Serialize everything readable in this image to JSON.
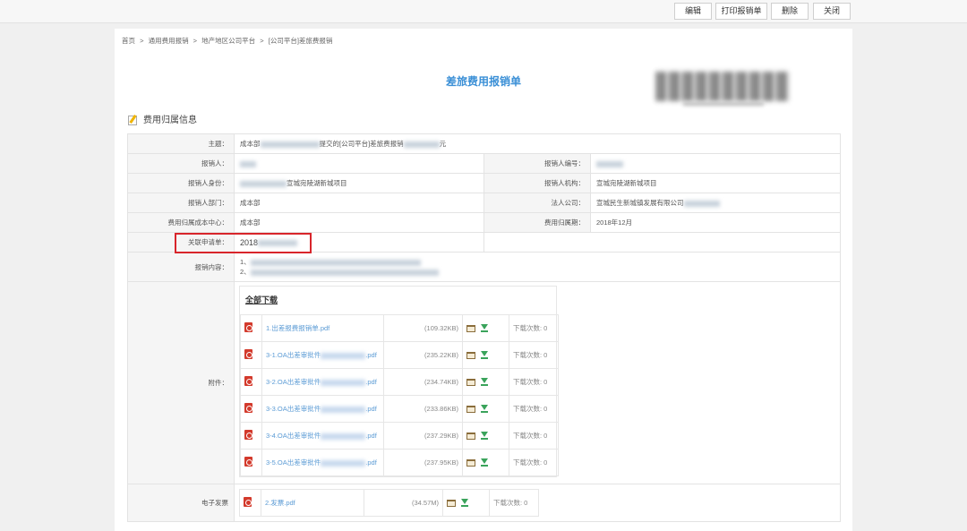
{
  "toolbar": {
    "edit": "编辑",
    "print": "打印报销单",
    "delete": "删除",
    "close": "关闭"
  },
  "breadcrumb": [
    "首页",
    ">",
    "通用费用报销",
    ">",
    "地产地区公司平台",
    ">",
    "[公司平台]差旅费报销"
  ],
  "form_title": "差旅费用报销单",
  "section_title": "费用归属信息",
  "fields": {
    "subject_label": "主题：",
    "subject_prefix": "成本部",
    "subject_mid": "提交的[公司平台]差旅费报销",
    "subject_suffix": "元",
    "claimant_label": "报销人：",
    "claimant_no_label": "报销人编号：",
    "id_label": "报销人身份：",
    "id_value": "宣城宛陵湖新城项目",
    "org_label": "报销人机构：",
    "org_value": "宣城宛陵湖新城项目",
    "dept_label": "报销人部门：",
    "dept_value": "成本部",
    "company_label": "法人公司：",
    "company_value": "宣城民生新城镇发展有限公司",
    "cost_center_label": "费用归属成本中心：",
    "cost_center_value": "成本部",
    "period_label": "费用归属期：",
    "period_value": "2018年12月",
    "linked_label": "关联申请单：",
    "linked_value": "2018",
    "content_label": "报销内容：",
    "content_line1": "1、",
    "content_line2": "2、",
    "attach_label": "附件：",
    "einvoice_label": "电子发票"
  },
  "download_all": "全部下载",
  "attachments": [
    {
      "name": "1.出差报费报销单.pdf",
      "size": "(109.32KB)",
      "count": "下载次数: 0"
    },
    {
      "name_prefix": "3-1.OA出差审批件",
      "ext": ".pdf",
      "size": "(235.22KB)",
      "count": "下载次数: 0"
    },
    {
      "name_prefix": "3-2.OA出差审批件",
      "ext": ".pdf",
      "size": "(234.74KB)",
      "count": "下载次数: 0"
    },
    {
      "name_prefix": "3-3.OA出差审批件",
      "ext": ".pdf",
      "size": "(233.86KB)",
      "count": "下载次数: 0"
    },
    {
      "name_prefix": "3-4.OA出差审批件",
      "ext": ".pdf",
      "size": "(237.29KB)",
      "count": "下载次数: 0"
    },
    {
      "name_prefix": "3-5.OA出差审批件",
      "ext": ".pdf",
      "size": "(237.95KB)",
      "count": "下载次数: 0"
    }
  ],
  "einvoice": {
    "name": "2.发票.pdf",
    "size": "(34.57M)",
    "count": "下载次数: 0"
  },
  "colors": {
    "accent": "#3a8fd6",
    "highlight": "#d8252b",
    "pdf": "#d33a2c",
    "download": "#3aa35b"
  }
}
